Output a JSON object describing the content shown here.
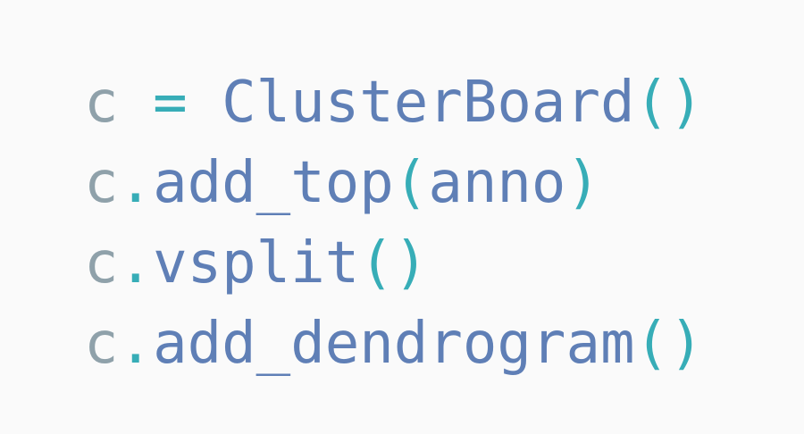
{
  "colors": {
    "background": "#fafafa",
    "variable": "#8fa1aa",
    "operator": "#37adb7",
    "identifier": "#5f7fb6"
  },
  "code": {
    "lines": [
      {
        "var": "c",
        "op": " = ",
        "name": "ClusterBoard",
        "open": "(",
        "arg": "",
        "close": ")"
      },
      {
        "var": "c",
        "op": ".",
        "name": "add_top",
        "open": "(",
        "arg": "anno",
        "close": ")"
      },
      {
        "var": "c",
        "op": ".",
        "name": "vsplit",
        "open": "(",
        "arg": "",
        "close": ")"
      },
      {
        "var": "c",
        "op": ".",
        "name": "add_dendrogram",
        "open": "(",
        "arg": "",
        "close": ")"
      }
    ]
  }
}
